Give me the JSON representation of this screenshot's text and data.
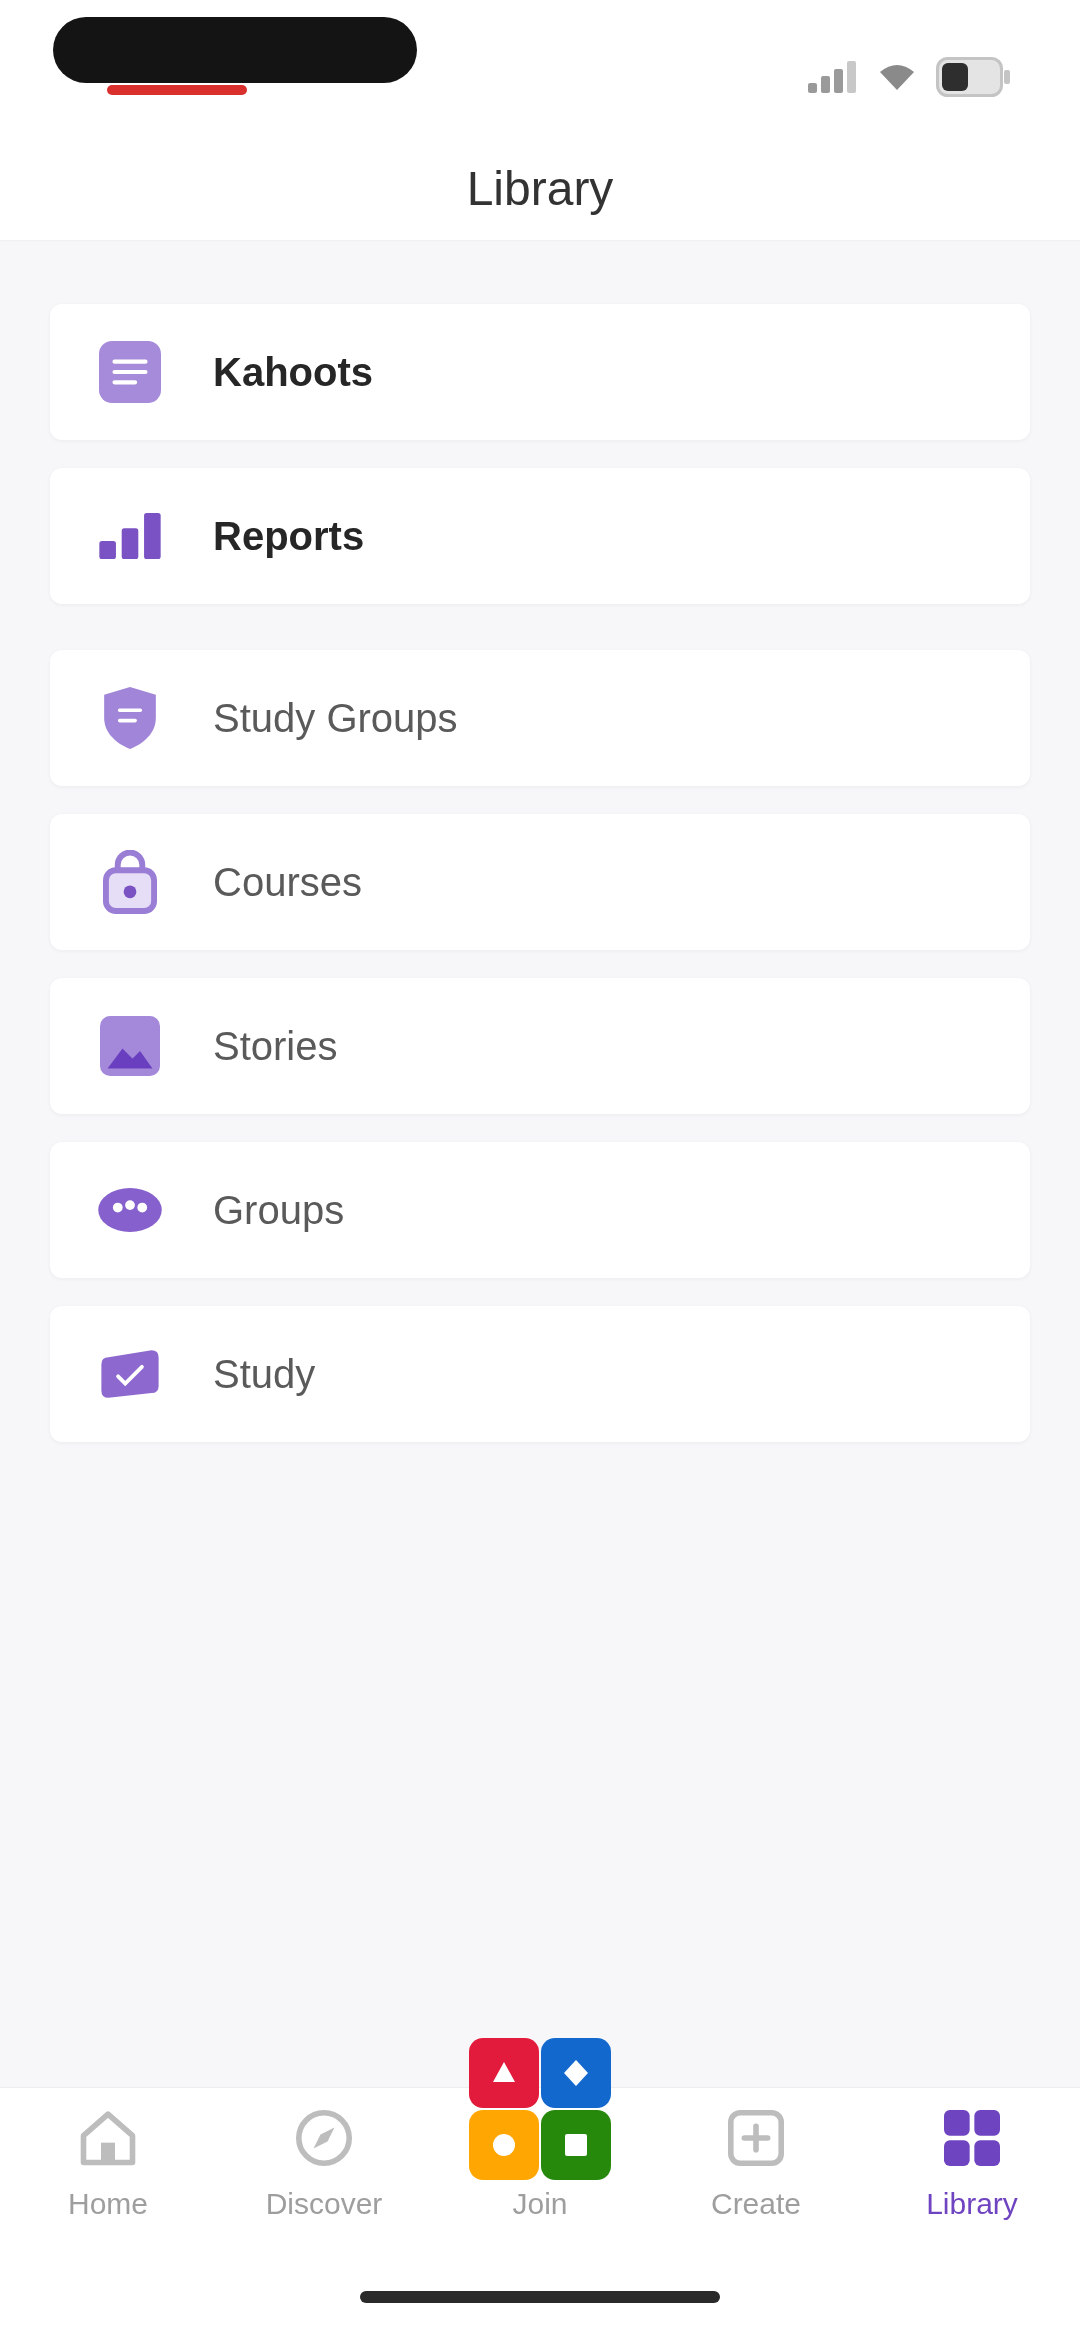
{
  "header": {
    "title": "Library"
  },
  "sections": [
    {
      "kind": "featured",
      "items": [
        {
          "label": "Kahoots"
        },
        {
          "label": "Reports"
        }
      ]
    },
    {
      "kind": "standard",
      "items": [
        {
          "label": "Study Groups"
        },
        {
          "label": "Courses"
        },
        {
          "label": "Stories"
        },
        {
          "label": "Groups"
        },
        {
          "label": "Study"
        }
      ]
    }
  ],
  "bottom_nav": [
    {
      "kind": "tab",
      "label": "Home",
      "selected": false
    },
    {
      "kind": "tab",
      "label": "Discover",
      "selected": false
    },
    {
      "kind": "join",
      "label": "Join",
      "selected": false
    },
    {
      "kind": "tab",
      "label": "Create",
      "selected": false
    },
    {
      "kind": "tab",
      "label": "Library",
      "selected": true
    }
  ]
}
